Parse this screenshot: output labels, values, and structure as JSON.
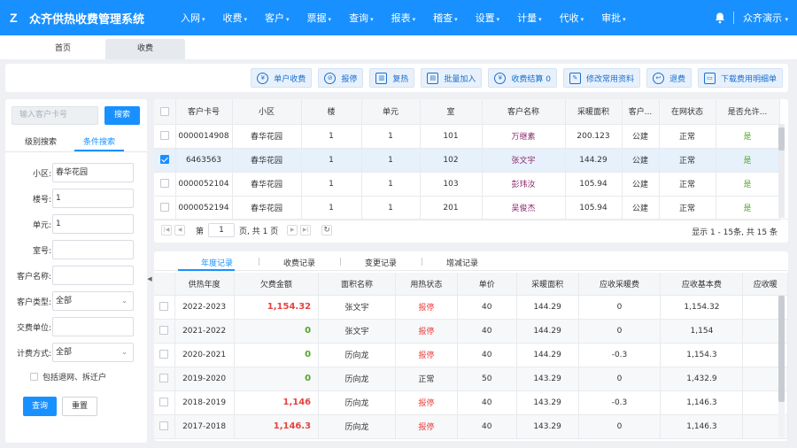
{
  "header": {
    "logo_glyph": "Z",
    "app_title": "众齐供热收费管理系统",
    "menu": [
      "入网",
      "收费",
      "客户",
      "票据",
      "查询",
      "报表",
      "稽查",
      "设置",
      "计量",
      "代收",
      "审批"
    ],
    "menu_caret": "▾",
    "user": "众齐演示",
    "bg_color": "#1890ff"
  },
  "tabs": [
    "首页",
    "收费"
  ],
  "toolbar": {
    "buttons": [
      {
        "label": "单户收费",
        "icon": "yen-icon"
      },
      {
        "label": "报停",
        "icon": "stop-icon"
      },
      {
        "label": "复热",
        "icon": "radiator-icon"
      },
      {
        "label": "批量加入",
        "icon": "batch-add-icon"
      },
      {
        "label": "收费结算 0",
        "icon": "settlement-icon"
      },
      {
        "label": "修改常用资料",
        "icon": "edit-icon"
      },
      {
        "label": "退费",
        "icon": "refund-icon"
      },
      {
        "label": "下载费用明细单",
        "icon": "printer-icon"
      }
    ]
  },
  "search": {
    "card_placeholder": "输入客户卡号",
    "search_button": "搜索",
    "tabs": [
      "级别搜索",
      "条件搜索"
    ],
    "active_tab": "条件搜索",
    "fields": [
      {
        "label": "小区:",
        "value": "春华花园",
        "type": "input"
      },
      {
        "label": "楼号:",
        "value": "1",
        "type": "input"
      },
      {
        "label": "单元:",
        "value": "1",
        "type": "input"
      },
      {
        "label": "室号:",
        "value": "",
        "type": "input"
      },
      {
        "label": "客户名称:",
        "value": "",
        "type": "input"
      },
      {
        "label": "客户类型:",
        "value": "全部",
        "type": "select"
      },
      {
        "label": "交费单位:",
        "value": "",
        "type": "input"
      },
      {
        "label": "计费方式:",
        "value": "全部",
        "type": "select"
      }
    ],
    "select_arrow": "⌄",
    "include_checkbox_label": "包括退网、拆迁户",
    "query_button": "查询",
    "reset_button": "重置",
    "collapse_glyph": "◀"
  },
  "customers": {
    "columns": [
      "",
      "客户卡号",
      "小区",
      "楼",
      "单元",
      "室",
      "客户名称",
      "采暖面积",
      "客户...",
      "在网状态",
      "是否允许..."
    ],
    "rows": [
      {
        "checked": false,
        "card": "0000014908",
        "community": "春华花园",
        "building": "1",
        "unit": "1",
        "room": "101",
        "name": "万继素",
        "area": "200.123",
        "type": "公建",
        "status": "正常",
        "allow": "是"
      },
      {
        "checked": true,
        "card": "6463563",
        "community": "春华花园",
        "building": "1",
        "unit": "1",
        "room": "102",
        "name": "张文宇",
        "area": "144.29",
        "type": "公建",
        "status": "正常",
        "allow": "是"
      },
      {
        "checked": false,
        "card": "0000052104",
        "community": "春华花园",
        "building": "1",
        "unit": "1",
        "room": "103",
        "name": "彭玮汝",
        "area": "105.94",
        "type": "公建",
        "status": "正常",
        "allow": "是"
      },
      {
        "checked": false,
        "card": "0000052194",
        "community": "春华花园",
        "building": "1",
        "unit": "1",
        "room": "201",
        "name": "吴俊杰",
        "area": "105.94",
        "type": "公建",
        "status": "正常",
        "allow": "是"
      }
    ],
    "pager": {
      "page_label": "第",
      "page_value": "1",
      "page_suffix": "页, 共 1 页",
      "info": "显示 1 - 15条, 共 15 条",
      "first_glyph": "|◀",
      "prev_glyph": "◀",
      "next_glyph": "▶",
      "last_glyph": "▶|",
      "refresh_glyph": "↻"
    }
  },
  "records": {
    "tabs": [
      "年度记录",
      "收费记录",
      "变更记录",
      "增减记录"
    ],
    "active_tab": "年度记录",
    "columns": [
      "",
      "供热年度",
      "欠费金额",
      "面积名称",
      "用热状态",
      "单价",
      "采暖面积",
      "应收采暖费",
      "应收基本费",
      "应收暖"
    ],
    "rows": [
      {
        "year": "2022-2023",
        "owed": "1,154.32",
        "owed_color": "red",
        "area_name": "张文宇",
        "heat_status": "报停",
        "heat_color": "red",
        "price": "40",
        "area": "144.29",
        "heating_fee": "0",
        "base_fee": "1,154.32"
      },
      {
        "year": "2021-2022",
        "owed": "0",
        "owed_color": "green",
        "area_name": "张文宇",
        "heat_status": "报停",
        "heat_color": "red",
        "price": "40",
        "area": "144.29",
        "heating_fee": "0",
        "base_fee": "1,154"
      },
      {
        "year": "2020-2021",
        "owed": "0",
        "owed_color": "green",
        "area_name": "历向龙",
        "heat_status": "报停",
        "heat_color": "red",
        "price": "40",
        "area": "144.29",
        "heating_fee": "-0.3",
        "base_fee": "1,154.3"
      },
      {
        "year": "2019-2020",
        "owed": "0",
        "owed_color": "green",
        "area_name": "历向龙",
        "heat_status": "正常",
        "heat_color": "normal",
        "price": "50",
        "area": "143.29",
        "heating_fee": "0",
        "base_fee": "1,432.9"
      },
      {
        "year": "2018-2019",
        "owed": "1,146",
        "owed_color": "red",
        "area_name": "历向龙",
        "heat_status": "报停",
        "heat_color": "red",
        "price": "40",
        "area": "143.29",
        "heating_fee": "-0.3",
        "base_fee": "1,146.3"
      },
      {
        "year": "2017-2018",
        "owed": "1,146.3",
        "owed_color": "red",
        "area_name": "历向龙",
        "heat_status": "报停",
        "heat_color": "red",
        "price": "40",
        "area": "143.29",
        "heating_fee": "0",
        "base_fee": "1,146.3"
      }
    ]
  }
}
